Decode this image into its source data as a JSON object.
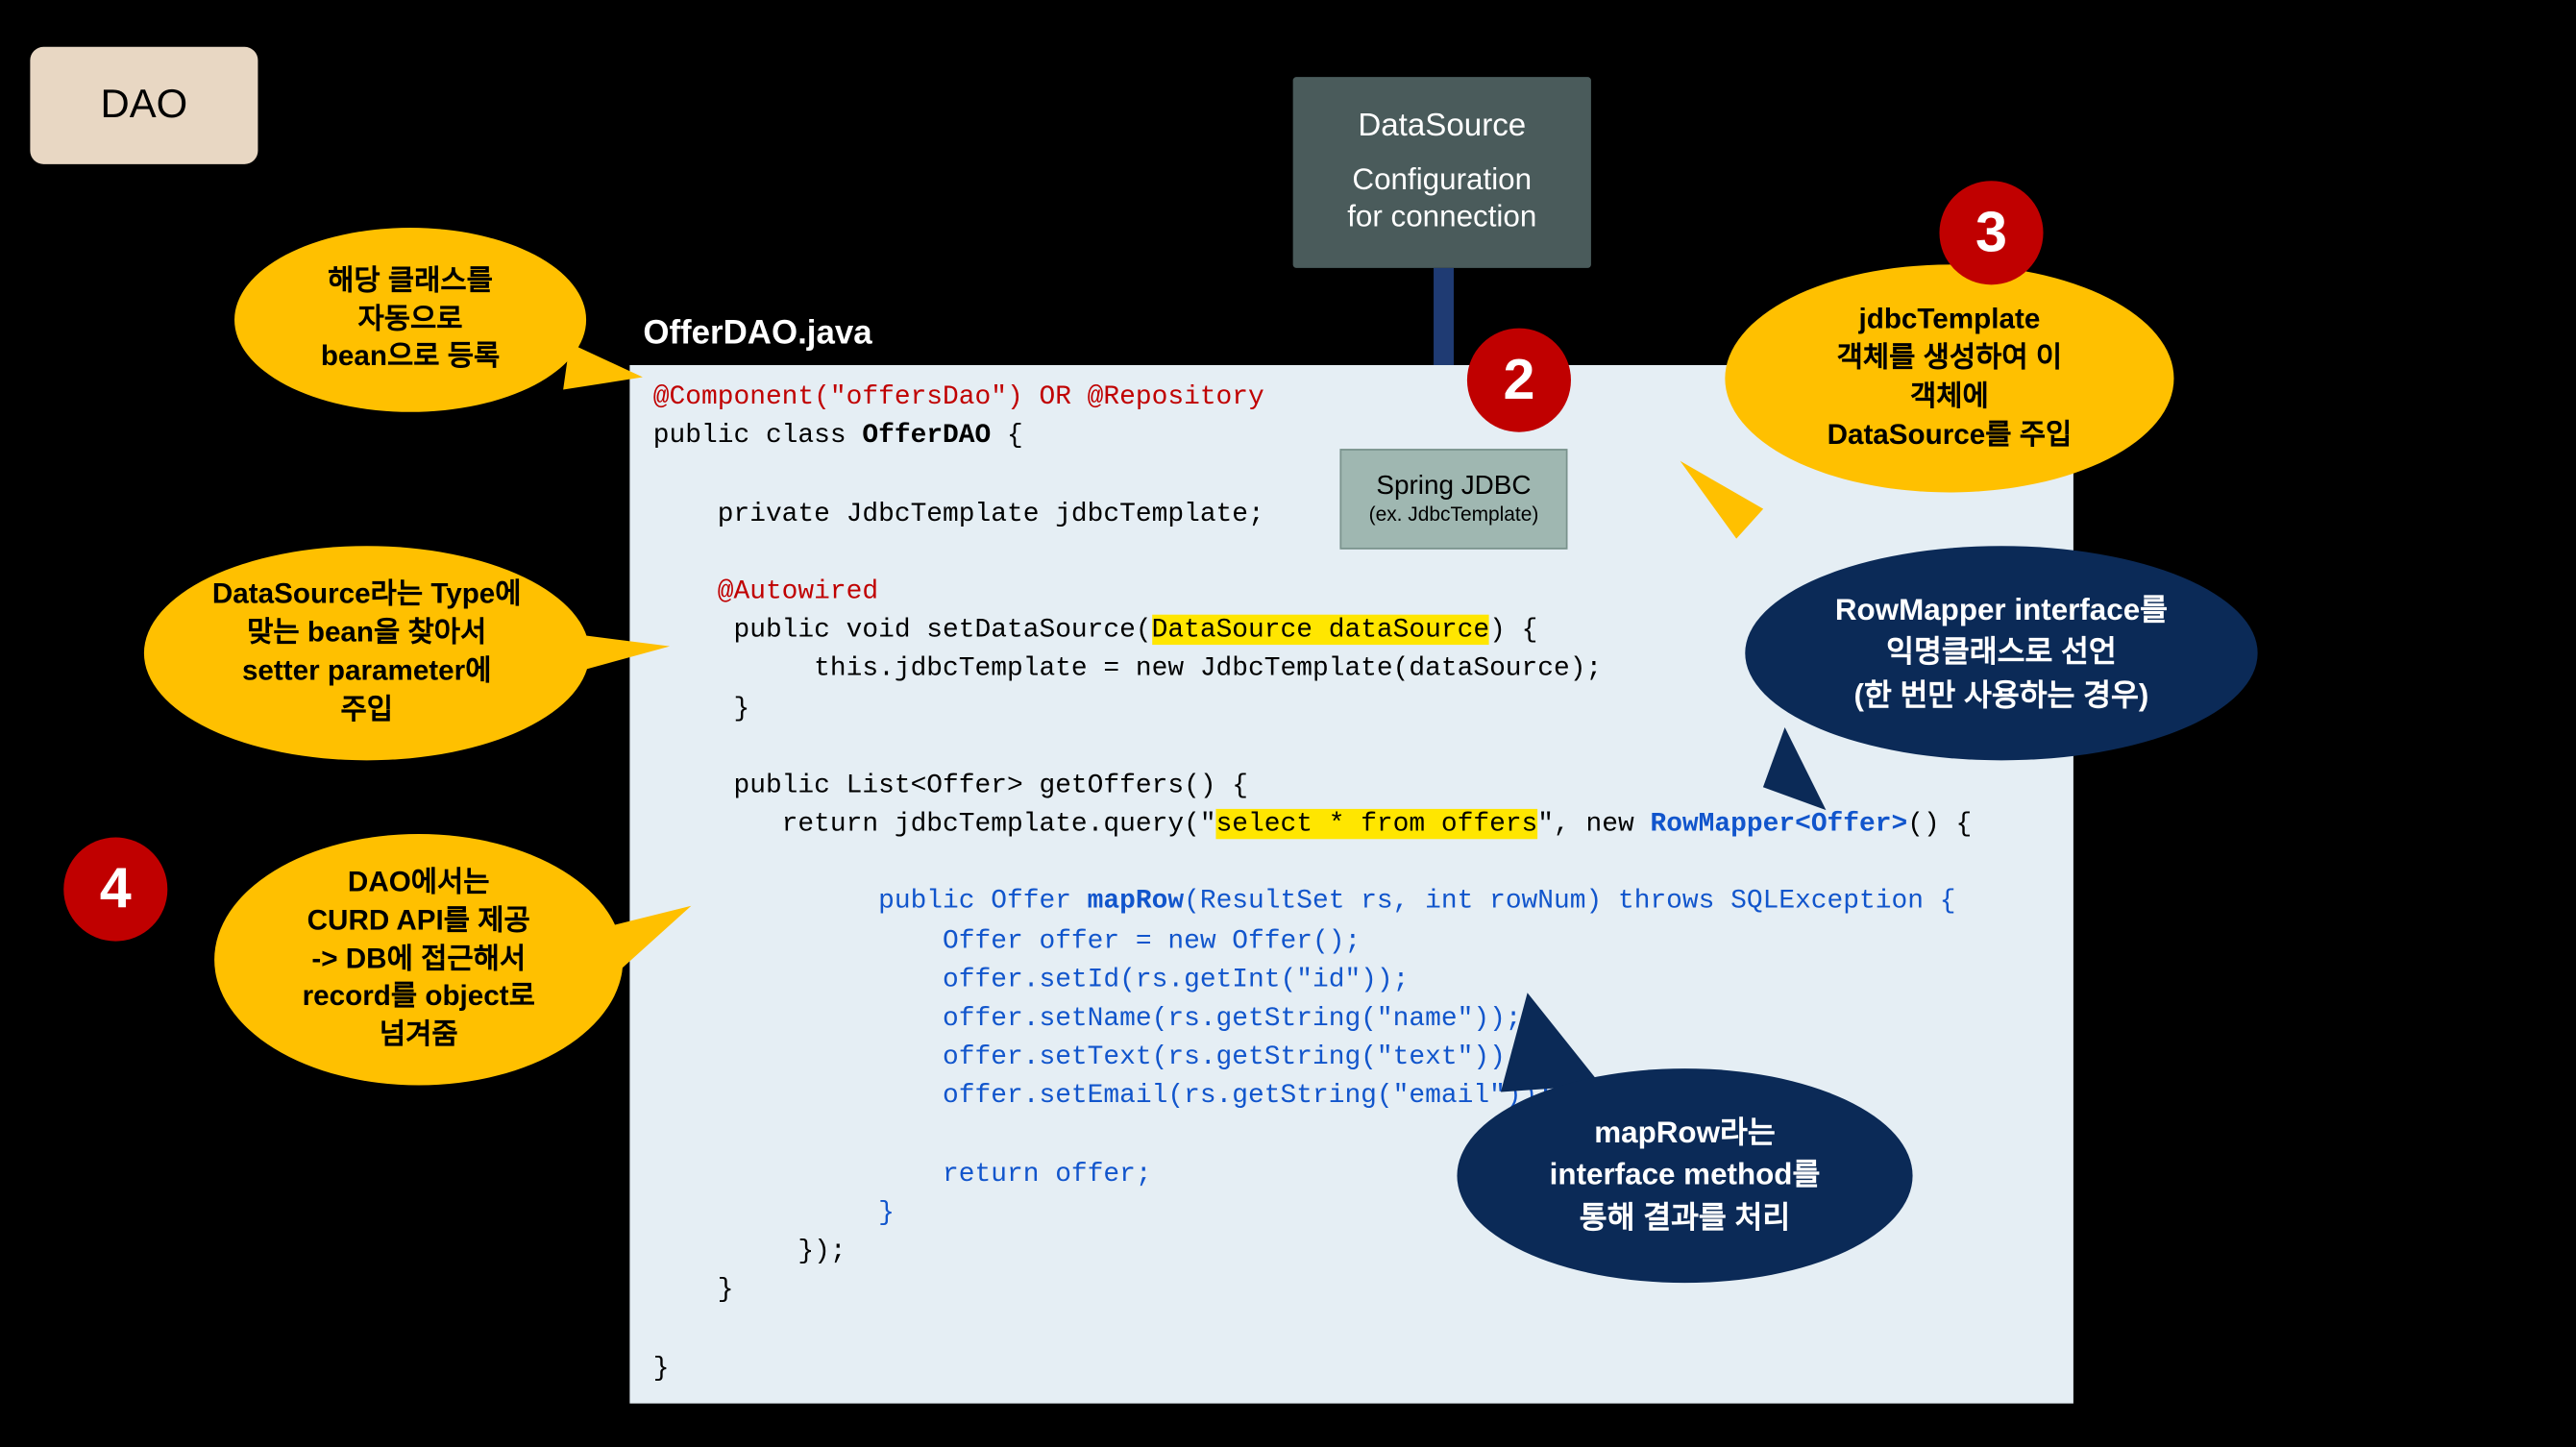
{
  "tag": {
    "dao": "DAO"
  },
  "flow": {
    "datasource_title": "DataSource",
    "datasource_sub": "Configuration\nfor connection",
    "springjdbc_title": "Spring JDBC",
    "springjdbc_sub": "(ex. JdbcTemplate)"
  },
  "numbers": {
    "n2": "2",
    "n3": "3",
    "n4": "4"
  },
  "code": {
    "filename": "OfferDAO.java",
    "ann_component": "@Component(\"offersDao\") OR @Repository",
    "class_decl": "public class ",
    "class_name": "OfferDAO",
    "class_open": " {",
    "field": "    private JdbcTemplate jdbcTemplate;",
    "ann_autowired": "    @Autowired",
    "setds_sig_a": "     public void setDataSource(",
    "setds_param": "DataSource dataSource",
    "setds_sig_b": ") {",
    "setds_body": "          this.jdbcTemplate = new JdbcTemplate(dataSource);",
    "setds_close": "     }",
    "getoffers_sig": "     public List<Offer> getOffers() {",
    "query_a": "        return jdbcTemplate.query(\"",
    "query_sql": "select * from offers",
    "query_b": "\", new ",
    "rowmapper": "RowMapper<Offer>",
    "query_c": "() {",
    "maprow_sig_a": "              public Offer ",
    "maprow_name": "mapRow",
    "maprow_sig_b": "(ResultSet rs, int rowNum) throws SQLException {",
    "mr1": "                  Offer offer = new Offer();",
    "mr2": "                  offer.setId(rs.getInt(\"id\"));",
    "mr3": "                  offer.setName(rs.getString(\"name\"));",
    "mr4": "                  offer.setText(rs.getString(\"text\"));",
    "mr5": "                  offer.setEmail(rs.getString(\"email\"));",
    "mr_blank": "",
    "mr_return": "                  return offer;",
    "mr_close": "              }",
    "anon_close": "         });",
    "getoffers_close": "    }",
    "class_close": "}"
  },
  "callouts": {
    "orange1": "해당 클래스를\n자동으로\nbean으로 등록",
    "orange2": "DataSource라는 Type에\n맞는 bean을 찾아서\nsetter parameter에\n주입",
    "orange3": "jdbcTemplate\n객체를 생성하여 이\n객체에\nDataSource를 주입",
    "orange4": "DAO에서는\nCURD API를 제공\n-> DB에 접근해서\nrecord를 object로\n넘겨줌",
    "navy1": "RowMapper interface를\n익명클래스로 선언\n(한 번만 사용하는 경우)",
    "navy2": "mapRow라는\ninterface method를\n통해 결과를 처리"
  }
}
